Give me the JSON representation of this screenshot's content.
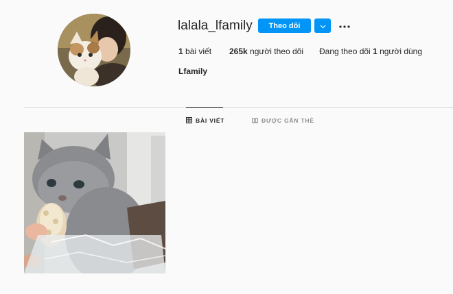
{
  "profile": {
    "username": "lalala_lfamily",
    "follow_label": "Theo dõi",
    "full_name": "Lfamily",
    "stats": {
      "posts_count": "1",
      "posts_label": " bài viết",
      "followers_count": "265k",
      "followers_label": " người theo dõi",
      "following_prefix": "Đang theo dõi ",
      "following_count": "1",
      "following_suffix": " người dùng"
    }
  },
  "tabs": [
    {
      "label": "BÀI VIẾT",
      "icon": "grid-icon",
      "active": true
    },
    {
      "label": "ĐƯỢC GẮN THẺ",
      "icon": "tag-icon",
      "active": false
    }
  ],
  "icons": {
    "dropdown": "chevron-down-icon",
    "more": "more-horizontal-icon"
  },
  "colors": {
    "accent": "#0095f6",
    "background": "#fafafa",
    "text": "#262626",
    "muted": "#8e8e8e",
    "border": "#dbdbdb"
  }
}
